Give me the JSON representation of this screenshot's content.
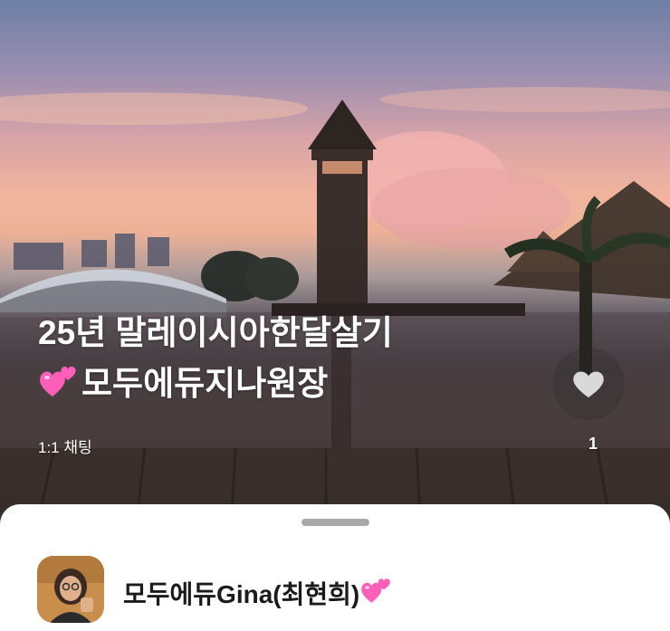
{
  "room": {
    "title_line1": "25년 말레이시아한달살기",
    "title_line2": "모두에듀지나원장",
    "chat_type": "1:1 채팅",
    "like_count": "1"
  },
  "host": {
    "name": "모두에듀Gina(최현희)"
  },
  "icons": {
    "title_emoji": "two-hearts-icon",
    "name_emoji": "two-hearts-icon",
    "like": "heart-icon",
    "avatar": "avatar"
  },
  "colors": {
    "title_text": "#ffffff",
    "sheet_background": "#ffffff",
    "heart_pink": "#ff5fb8",
    "like_heart": "#d9d9d9"
  }
}
